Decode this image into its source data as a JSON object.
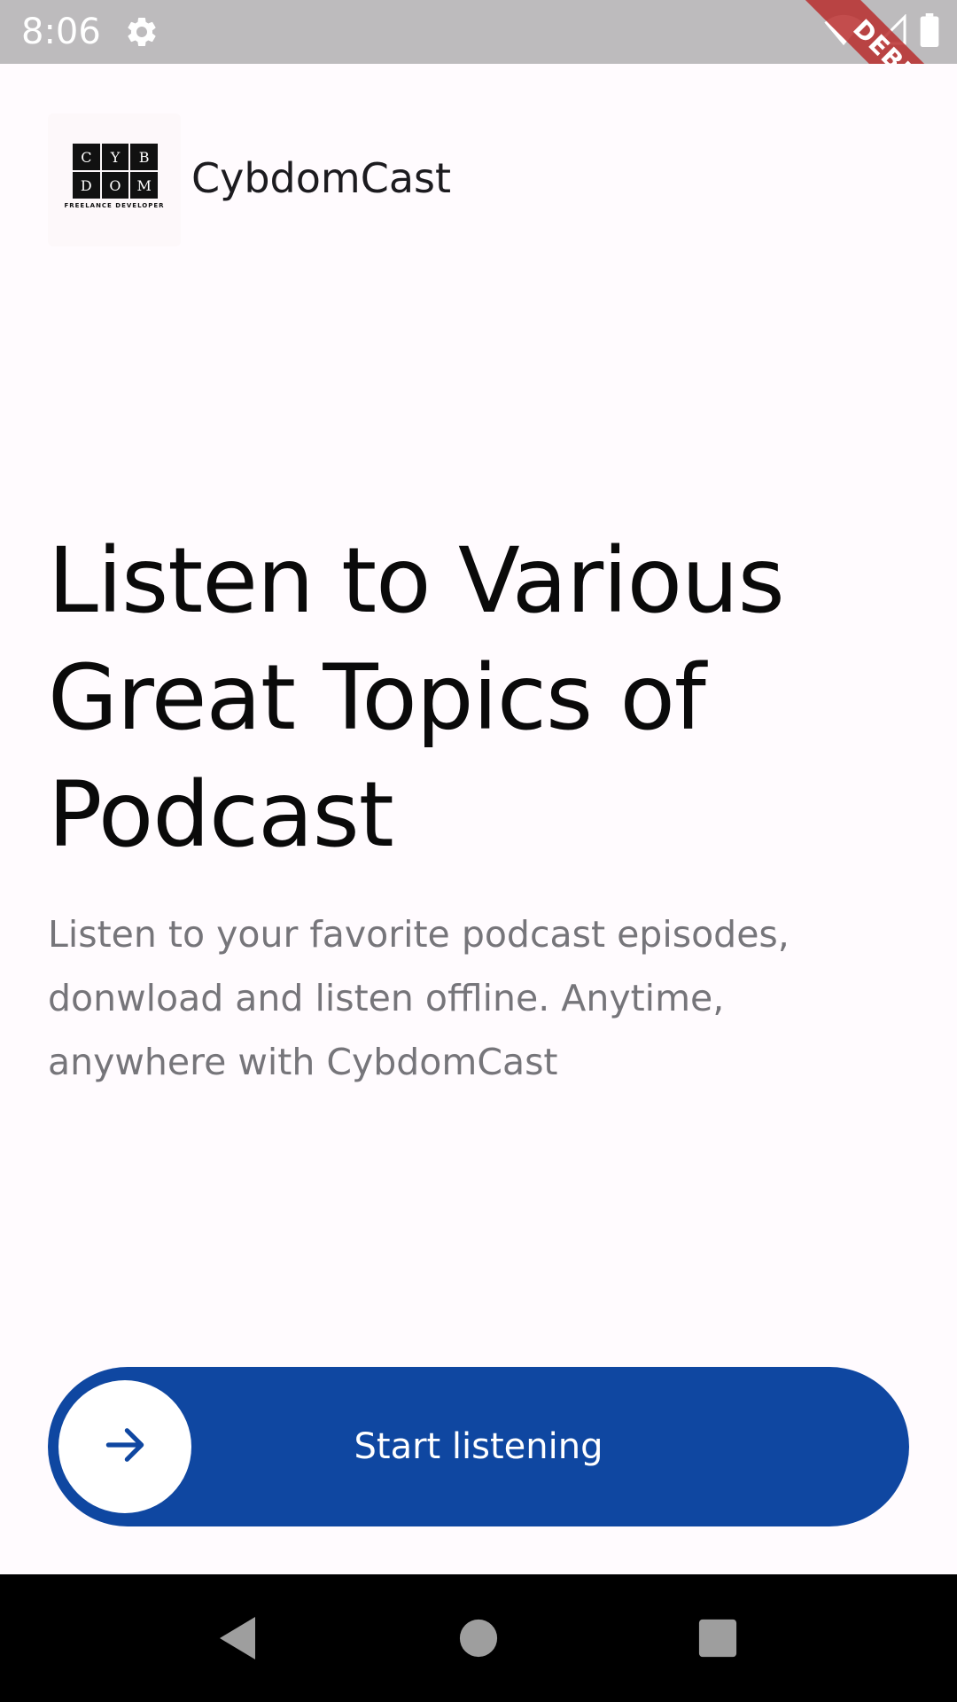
{
  "status_bar": {
    "time": "8:06",
    "settings_icon": "gear-icon",
    "wifi_icon": "wifi-icon",
    "signal_icon": "signal-icon",
    "battery_icon": "battery-icon",
    "debug_banner": "DEBUG",
    "background_color": "#bdbbbd"
  },
  "header": {
    "logo_letters": [
      "C",
      "Y",
      "B",
      "D",
      "O",
      "M"
    ],
    "logo_tagline": "FREELANCE DEVELOPER",
    "app_name": "CybdomCast"
  },
  "hero": {
    "headline": "Listen to Various Great Topics of Podcast",
    "subtitle": "Listen to your favorite podcast episodes, donwload and listen offline. Anytime, anywhere with CybdomCast"
  },
  "cta": {
    "label": "Start listening",
    "knob_icon": "arrow-right-icon",
    "accent_color": "#0f47a1"
  },
  "nav_bar": {
    "back_icon": "back-triangle-icon",
    "home_icon": "home-circle-icon",
    "recents_icon": "recents-square-icon"
  }
}
